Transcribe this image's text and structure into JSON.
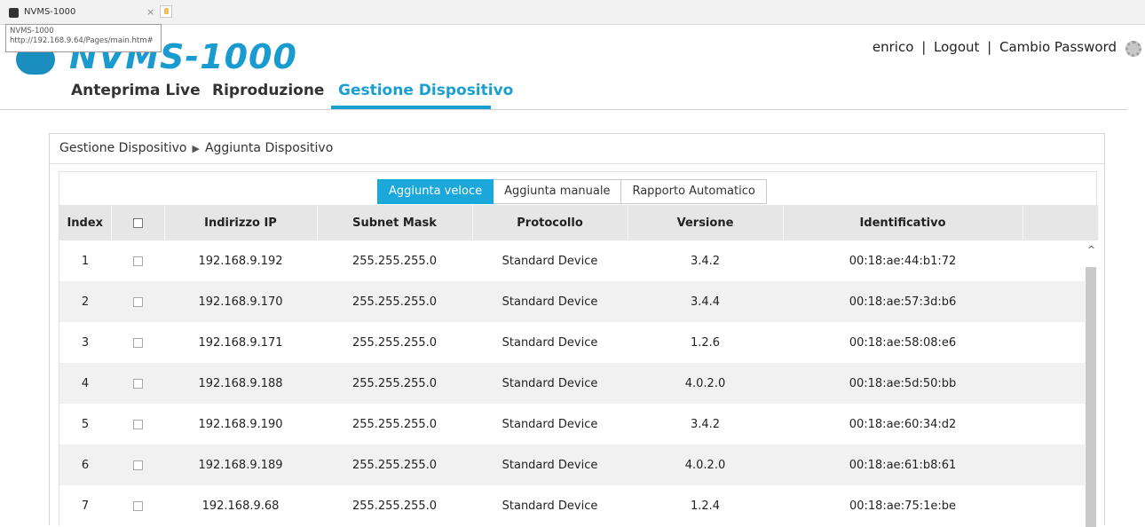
{
  "browser": {
    "tab_title": "NVMS-1000",
    "tab_close": "×",
    "tooltip_title": "NVMS-1000",
    "tooltip_url": "http://192.168.9.64/Pages/main.htm#"
  },
  "app": {
    "logo_text": "NVMS-1000",
    "brand_color": "#1a9bd0"
  },
  "userbar": {
    "username": "enrico",
    "sep1": "|",
    "logout": "Logout",
    "sep2": "|",
    "change_password": "Cambio Password"
  },
  "nav": {
    "items": [
      {
        "label": "Anteprima Live",
        "active": false
      },
      {
        "label": "Riproduzione",
        "active": false
      },
      {
        "label": "Gestione Dispositivo",
        "active": true
      }
    ]
  },
  "breadcrumb": {
    "root": "Gestione Dispositivo",
    "separator": "▶",
    "current": "Aggiunta Dispositivo"
  },
  "buttons": {
    "quick_add": "Aggiunta veloce",
    "manual_add": "Aggiunta manuale",
    "auto_report": "Rapporto Automatico"
  },
  "table": {
    "headers": [
      "Index",
      "",
      "Indirizzo IP",
      "Subnet Mask",
      "Protocollo",
      "Versione",
      "Identificativo"
    ],
    "rows": [
      {
        "index": "1",
        "ip": "192.168.9.192",
        "mask": "255.255.255.0",
        "protocol": "Standard Device",
        "version": "3.4.2",
        "id": "00:18:ae:44:b1:72"
      },
      {
        "index": "2",
        "ip": "192.168.9.170",
        "mask": "255.255.255.0",
        "protocol": "Standard Device",
        "version": "3.4.4",
        "id": "00:18:ae:57:3d:b6"
      },
      {
        "index": "3",
        "ip": "192.168.9.171",
        "mask": "255.255.255.0",
        "protocol": "Standard Device",
        "version": "1.2.6",
        "id": "00:18:ae:58:08:e6"
      },
      {
        "index": "4",
        "ip": "192.168.9.188",
        "mask": "255.255.255.0",
        "protocol": "Standard Device",
        "version": "4.0.2.0",
        "id": "00:18:ae:5d:50:bb"
      },
      {
        "index": "5",
        "ip": "192.168.9.190",
        "mask": "255.255.255.0",
        "protocol": "Standard Device",
        "version": "3.4.2",
        "id": "00:18:ae:60:34:d2"
      },
      {
        "index": "6",
        "ip": "192.168.9.189",
        "mask": "255.255.255.0",
        "protocol": "Standard Device",
        "version": "4.0.2.0",
        "id": "00:18:ae:61:b8:61"
      },
      {
        "index": "7",
        "ip": "192.168.9.68",
        "mask": "255.255.255.0",
        "protocol": "Standard Device",
        "version": "1.2.4",
        "id": "00:18:ae:75:1e:be"
      }
    ]
  },
  "scrollbar": {
    "up_glyph": "^"
  }
}
